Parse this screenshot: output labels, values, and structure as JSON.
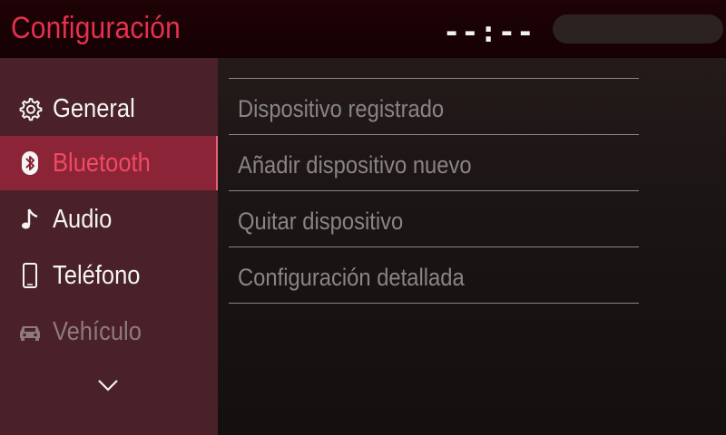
{
  "header": {
    "title": "Configuración",
    "clock": "--:--"
  },
  "sidebar": {
    "items": [
      {
        "label": "General",
        "icon": "gear-icon",
        "state": "normal"
      },
      {
        "label": "Bluetooth",
        "icon": "bluetooth-icon",
        "state": "selected"
      },
      {
        "label": "Audio",
        "icon": "music-note-icon",
        "state": "normal"
      },
      {
        "label": "Teléfono",
        "icon": "phone-icon",
        "state": "normal"
      },
      {
        "label": "Vehículo",
        "icon": "car-icon",
        "state": "disabled"
      }
    ],
    "more_icon": "chevron-down-icon"
  },
  "bluetooth_menu": {
    "items": [
      {
        "label": "Dispositivo registrado"
      },
      {
        "label": "Añadir dispositivo nuevo"
      },
      {
        "label": "Quitar dispositivo"
      },
      {
        "label": "Configuración detallada"
      }
    ]
  },
  "colors": {
    "accent": "#e3314f",
    "sidebar_bg": "#4a2129",
    "selected_bg": "#8c2438",
    "header_bg": "#1e0205"
  }
}
